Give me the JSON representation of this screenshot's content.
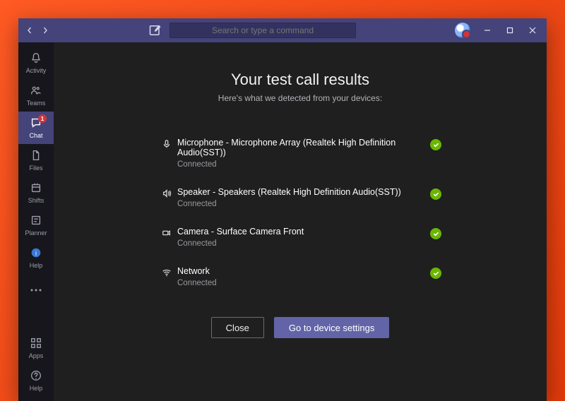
{
  "titlebar": {
    "search_placeholder": "Search or type a command"
  },
  "rail": {
    "items": [
      {
        "label": "Activity",
        "icon": "bell",
        "selected": false,
        "badge": null
      },
      {
        "label": "Teams",
        "icon": "teams",
        "selected": false,
        "badge": null
      },
      {
        "label": "Chat",
        "icon": "chat",
        "selected": true,
        "badge": "1"
      },
      {
        "label": "Files",
        "icon": "files",
        "selected": false,
        "badge": null
      },
      {
        "label": "Shifts",
        "icon": "shifts",
        "selected": false,
        "badge": null
      },
      {
        "label": "Planner",
        "icon": "planner",
        "selected": false,
        "badge": null
      },
      {
        "label": "Help",
        "icon": "helpblue",
        "selected": false,
        "badge": null
      }
    ],
    "more_label": "",
    "bottom": [
      {
        "label": "Apps",
        "icon": "apps"
      },
      {
        "label": "Help",
        "icon": "help"
      }
    ]
  },
  "main": {
    "title": "Your test call results",
    "subtitle": "Here's what we detected from your devices:",
    "results": [
      {
        "icon": "mic",
        "name": "Microphone - Microphone Array (Realtek High Definition Audio(SST))",
        "status": "Connected",
        "ok": true
      },
      {
        "icon": "speaker",
        "name": "Speaker - Speakers (Realtek High Definition Audio(SST))",
        "status": "Connected",
        "ok": true
      },
      {
        "icon": "camera",
        "name": "Camera - Surface Camera Front",
        "status": "Connected",
        "ok": true
      },
      {
        "icon": "network",
        "name": "Network",
        "status": "Connected",
        "ok": true
      }
    ],
    "actions": {
      "close": "Close",
      "go_to_settings": "Go to device settings"
    }
  },
  "colors": {
    "accent": "#6264a7",
    "ok": "#6bb700",
    "badge": "#d13438"
  }
}
